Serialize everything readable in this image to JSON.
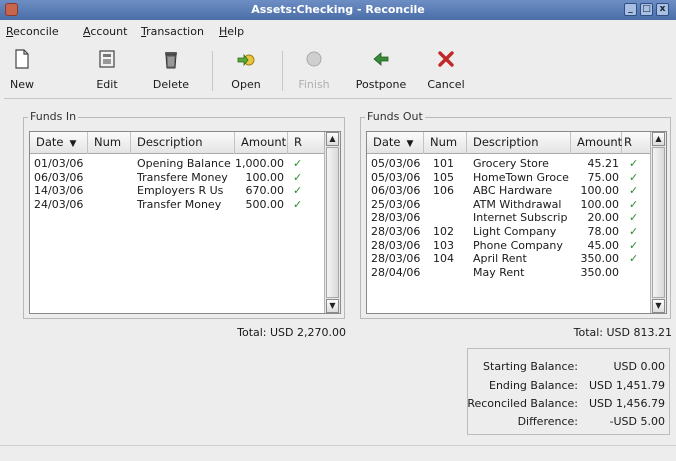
{
  "window": {
    "title": "Assets:Checking - Reconcile",
    "buttons": {
      "minimize": "_",
      "maximize": "□",
      "close": "x"
    }
  },
  "menu": {
    "items": [
      {
        "underline": "R",
        "rest": "econcile"
      },
      {
        "underline": "A",
        "rest": "ccount"
      },
      {
        "underline": "T",
        "rest": "ransaction"
      },
      {
        "underline": "H",
        "rest": "elp"
      }
    ]
  },
  "toolbar": {
    "new": "New",
    "edit": "Edit",
    "delete": "Delete",
    "open": "Open",
    "finish": "Finish",
    "postpone": "Postpone",
    "cancel": "Cancel"
  },
  "funds_in": {
    "label": "Funds In",
    "columns": {
      "date": "Date",
      "num": "Num",
      "description": "Description",
      "amount": "Amount",
      "r": "R"
    },
    "rows": [
      {
        "date": "01/03/06",
        "num": "",
        "description": "Opening Balance",
        "amount": "1,000.00",
        "r": "✓"
      },
      {
        "date": "06/03/06",
        "num": "",
        "description": "Transfere Money",
        "amount": "100.00",
        "r": "✓"
      },
      {
        "date": "14/03/06",
        "num": "",
        "description": "Employers R Us",
        "amount": "670.00",
        "r": "✓"
      },
      {
        "date": "24/03/06",
        "num": "",
        "description": "Transfer Money",
        "amount": "500.00",
        "r": "✓"
      }
    ],
    "total": "Total: USD 2,270.00"
  },
  "funds_out": {
    "label": "Funds Out",
    "columns": {
      "date": "Date",
      "num": "Num",
      "description": "Description",
      "amount": "Amount",
      "r": "R"
    },
    "rows": [
      {
        "date": "05/03/06",
        "num": "101",
        "description": "Grocery Store",
        "amount": "45.21",
        "r": "✓"
      },
      {
        "date": "05/03/06",
        "num": "105",
        "description": "HomeTown Groce",
        "amount": "75.00",
        "r": "✓"
      },
      {
        "date": "06/03/06",
        "num": "106",
        "description": "ABC Hardware",
        "amount": "100.00",
        "r": "✓"
      },
      {
        "date": "25/03/06",
        "num": "",
        "description": "ATM Withdrawal",
        "amount": "100.00",
        "r": "✓"
      },
      {
        "date": "28/03/06",
        "num": "",
        "description": "Internet Subscrip",
        "amount": "20.00",
        "r": "✓"
      },
      {
        "date": "28/03/06",
        "num": "102",
        "description": "Light Company",
        "amount": "78.00",
        "r": "✓"
      },
      {
        "date": "28/03/06",
        "num": "103",
        "description": "Phone Company",
        "amount": "45.00",
        "r": "✓"
      },
      {
        "date": "28/03/06",
        "num": "104",
        "description": "April Rent",
        "amount": "350.00",
        "r": "✓"
      },
      {
        "date": "28/04/06",
        "num": "",
        "description": "May Rent",
        "amount": "350.00",
        "r": ""
      }
    ],
    "total": "Total: USD 813.21"
  },
  "summary": {
    "starting_label": "Starting Balance:",
    "starting_value": "USD 0.00",
    "ending_label": "Ending Balance:",
    "ending_value": "USD 1,451.79",
    "reconciled_label": "Reconciled Balance:",
    "reconciled_value": "USD 1,456.79",
    "difference_label": "Difference:",
    "difference_value": "-USD 5.00"
  },
  "colors": {
    "titlebar": "#4b6ea8",
    "check": "#2a8a2a",
    "cancel_icon": "#c0282a"
  }
}
